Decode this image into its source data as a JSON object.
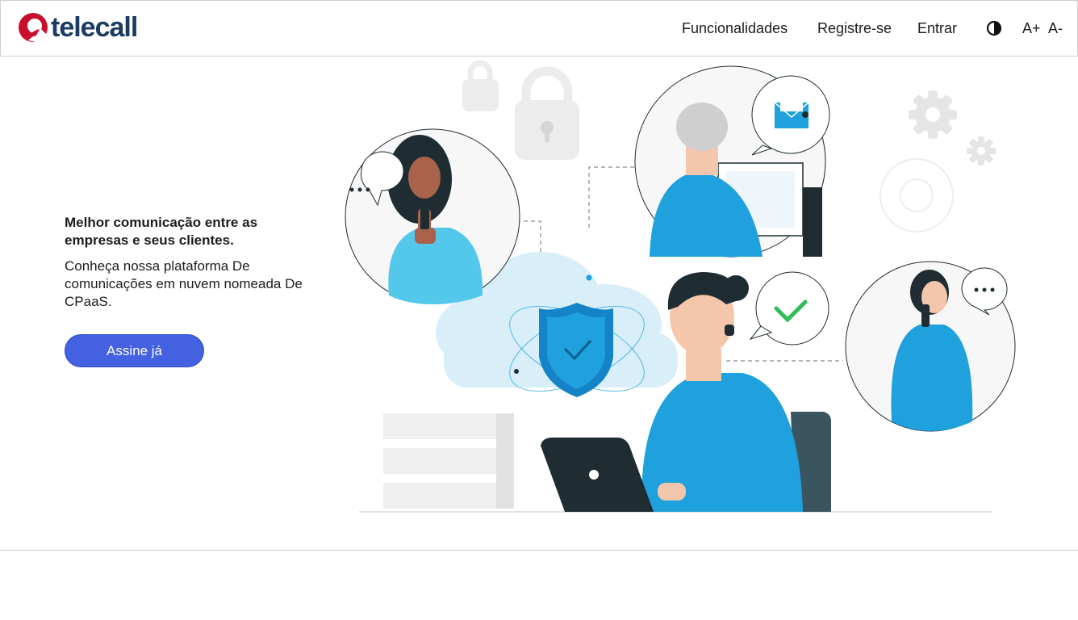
{
  "brand": {
    "logo_text": "telecall",
    "logo_color": "#1b3b63",
    "logo_mark_color": "#c8102e"
  },
  "nav": {
    "items": [
      {
        "label": "Funcionalidades"
      },
      {
        "label": "Registre-se"
      },
      {
        "label": "Entrar"
      }
    ],
    "contrast_icon": "contrast-icon",
    "font_increase": "A+",
    "font_decrease": "A-"
  },
  "hero": {
    "title": "Melhor comunicação entre as empresas e seus clientes.",
    "subtitle": "Conheça nossa plataforma De comunicações em nuvem nomeada De CPaaS.",
    "cta_label": "Assine já",
    "cta_color": "#4361e0"
  },
  "illustration": {
    "accent_color": "#1ea1dc",
    "dark_color": "#1f2d33",
    "check_color": "#2ebd59"
  }
}
